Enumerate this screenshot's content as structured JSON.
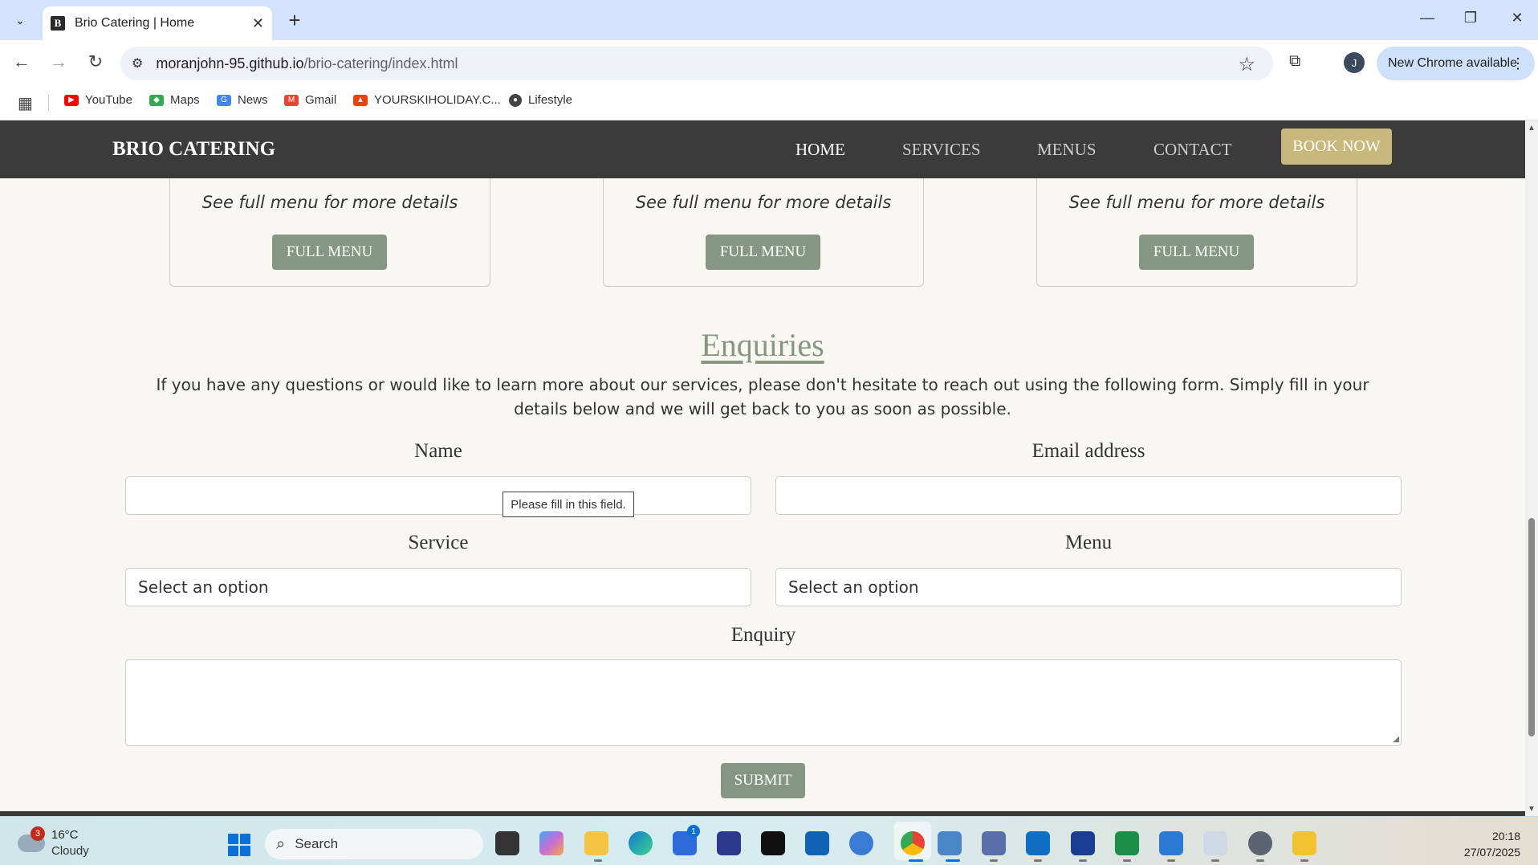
{
  "browser": {
    "tab_title": "Brio Catering | Home",
    "favicon_letter": "B",
    "url_host": "moranjohn-95.github.io",
    "url_path": "/brio-catering/index.html",
    "profile_initial": "J",
    "update_label": "New Chrome available",
    "bookmarks": [
      {
        "label": "YouTube",
        "color": "#ff0000"
      },
      {
        "label": "Maps",
        "color": "#34a853"
      },
      {
        "label": "News",
        "color": "#4285f4"
      },
      {
        "label": "Gmail",
        "color": "#ea4335"
      },
      {
        "label": "YOURSKIHOLIDAY.C...",
        "color": "#e8430f"
      },
      {
        "label": "Lifestyle",
        "color": "#444444"
      }
    ]
  },
  "site": {
    "brand": "BRIO CATERING",
    "nav": [
      "HOME",
      "SERVICES",
      "MENUS",
      "CONTACT"
    ],
    "book_now": "BOOK NOW",
    "cards": [
      {
        "text": "See full menu for more details",
        "button": "FULL MENU"
      },
      {
        "text": "See full menu for more details",
        "button": "FULL MENU"
      },
      {
        "text": "See full menu for more details",
        "button": "FULL MENU"
      }
    ],
    "enquiries": {
      "title": "Enquiries",
      "intro": "If you have any questions or would like to learn more about our services, please don't hesitate to reach out using the following form. Simply fill in your details below and we will get back to you as soon as possible.",
      "name_label": "Name",
      "email_label": "Email address",
      "service_label": "Service",
      "service_value": "Select an option",
      "menu_label": "Menu",
      "menu_value": "Select an option",
      "enquiry_label": "Enquiry",
      "validation_tooltip": "Please fill in this field.",
      "submit": "SUBMIT"
    },
    "colors": {
      "nav_bg": "#3b3b3b",
      "sage": "#869684",
      "gold": "#c9b87b",
      "page_bg": "#f8f7f2"
    }
  },
  "taskbar": {
    "weather_temp": "16°C",
    "weather_desc": "Cloudy",
    "weather_badge": "3",
    "search_label": "Search",
    "store_badge": "1",
    "time": "20:18",
    "date": "27/07/2025"
  }
}
